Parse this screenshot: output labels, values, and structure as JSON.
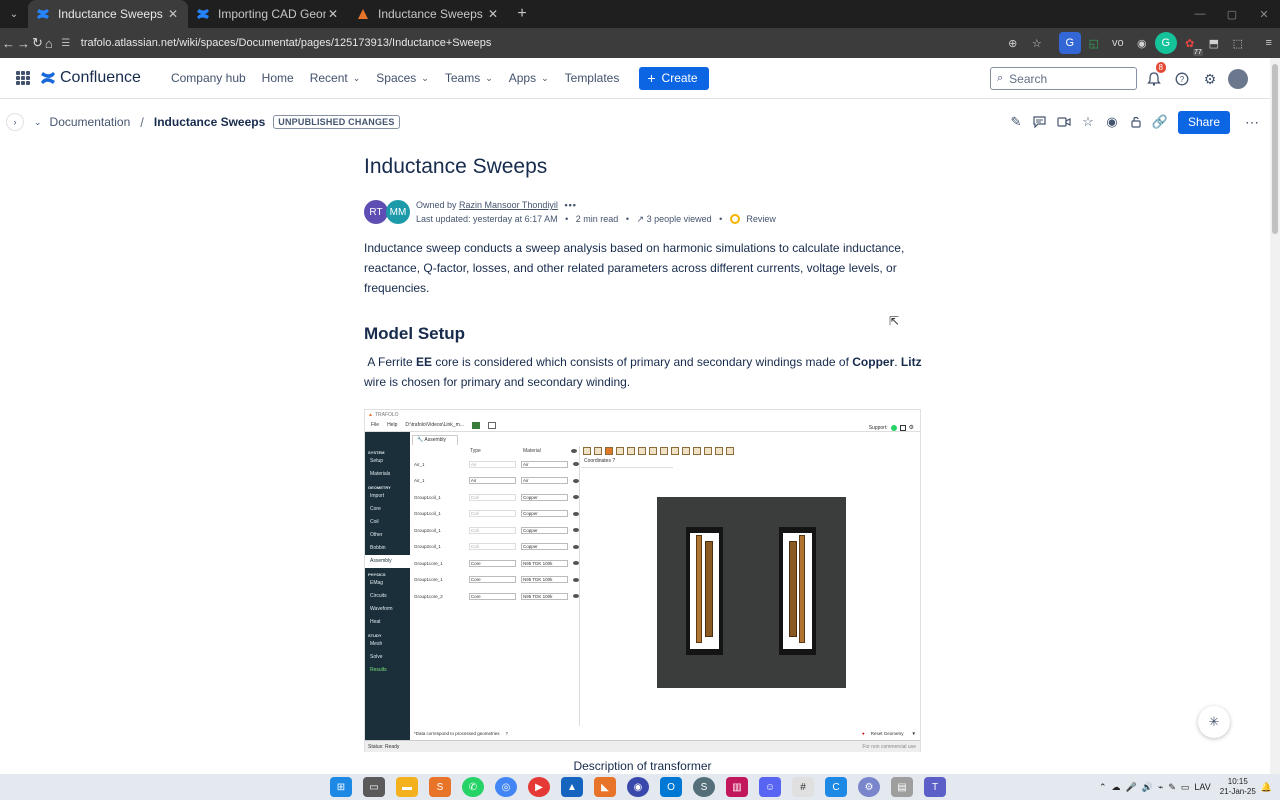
{
  "browser": {
    "tabs": [
      {
        "title": "Inductance Sweeps - Documen",
        "active": true
      },
      {
        "title": "Importing CAD Geometries - D",
        "active": false
      },
      {
        "title": "Inductance Sweeps – TRAFOLO",
        "active": false
      }
    ],
    "url": "trafolo.atlassian.net/wiki/spaces/Documentat/pages/125173913/Inductance+Sweeps"
  },
  "topnav": {
    "product": "Confluence",
    "links": [
      {
        "label": "Company hub",
        "dropdown": false
      },
      {
        "label": "Home",
        "dropdown": false
      },
      {
        "label": "Recent",
        "dropdown": true
      },
      {
        "label": "Spaces",
        "dropdown": true
      },
      {
        "label": "Teams",
        "dropdown": true
      },
      {
        "label": "Apps",
        "dropdown": true
      },
      {
        "label": "Templates",
        "dropdown": false
      }
    ],
    "create_label": "Create",
    "search_placeholder": "Search",
    "notifications_count": "8",
    "extension_badge": "77"
  },
  "pagebar": {
    "breadcrumb_space": "Documentation",
    "breadcrumb_current": "Inductance Sweeps",
    "unpublished_label": "UNPUBLISHED CHANGES",
    "share_label": "Share"
  },
  "page": {
    "title": "Inductance Sweeps",
    "avatars": [
      "RT",
      "MM"
    ],
    "owned_by_prefix": "Owned by",
    "owner": "Razin Mansoor Thondiyil",
    "last_updated": "Last updated: yesterday at 6:17 AM",
    "read_time": "2 min read",
    "viewed": "3 people viewed",
    "review": "Review",
    "intro": "Inductance sweep conducts a sweep analysis based on harmonic simulations to calculate inductance, reactance, Q-factor, losses, and other related parameters across different currents, voltage levels, or frequencies.",
    "section_heading": "Model Setup",
    "setup": {
      "t1": "A Ferrite ",
      "b1": "EE",
      "t2": " core is considered which consists of primary and secondary windings made of ",
      "b2": "Copper",
      "t3": ". ",
      "b3": "Litz",
      "t4": " wire is chosen for primary and secondary winding."
    },
    "caption": "Description of transformer"
  },
  "embedded_app": {
    "window_title": "TRAFOLO",
    "menu": [
      "File",
      "Help",
      "D:\\trafolo\\Videos\\Link_m..."
    ],
    "support_label": "Support:",
    "assembly_tab": "Assembly",
    "sidebar": {
      "groups": [
        {
          "name": "SYSTEM",
          "items": [
            "Setup",
            "Materials"
          ]
        },
        {
          "name": "GEOMETRY",
          "items": [
            "Import",
            "Core",
            "Coil",
            "Other",
            "Bobbin"
          ]
        },
        {
          "name": "",
          "items": [
            "Assembly"
          ]
        },
        {
          "name": "PHYSICS",
          "items": [
            "EMag",
            "Circuits",
            "Waveform",
            "Heat"
          ]
        },
        {
          "name": "STUDY",
          "items": [
            "Mesh",
            "Solve",
            "Results"
          ]
        }
      ]
    },
    "columns": [
      "Type",
      "Material"
    ],
    "rows": [
      {
        "name": "Air_1",
        "type": "Air",
        "material": "Air",
        "dim": true
      },
      {
        "name": "Air_1",
        "type": "Air",
        "material": "Air",
        "dim": false
      },
      {
        "name": "Group1coil_1",
        "type": "Coil",
        "material": "Copper",
        "dim": true
      },
      {
        "name": "Group1coil_1",
        "type": "Coil",
        "material": "Copper",
        "dim": true
      },
      {
        "name": "Group2coil_1",
        "type": "Coil",
        "material": "Copper",
        "dim": true
      },
      {
        "name": "Group2coil_1",
        "type": "Coil",
        "material": "Copper",
        "dim": true
      },
      {
        "name": "Group1core_1",
        "type": "Core",
        "material": "N95 TDK 100k",
        "dim": false
      },
      {
        "name": "Group1core_1",
        "type": "Core",
        "material": "N95 TDK 100k",
        "dim": false
      },
      {
        "name": "Group1core_2",
        "type": "Core",
        "material": "N95 TDK 100k",
        "dim": false
      }
    ],
    "coordinates_label": "Coordinates",
    "footnote": "*Data correspond to processed geometries",
    "reset_label": "Reset Geometry",
    "status": "Status: Ready",
    "license": "For non commercial use"
  },
  "taskbar": {
    "language": "LAV",
    "time": "10:15",
    "date": "21-Jan-25"
  }
}
